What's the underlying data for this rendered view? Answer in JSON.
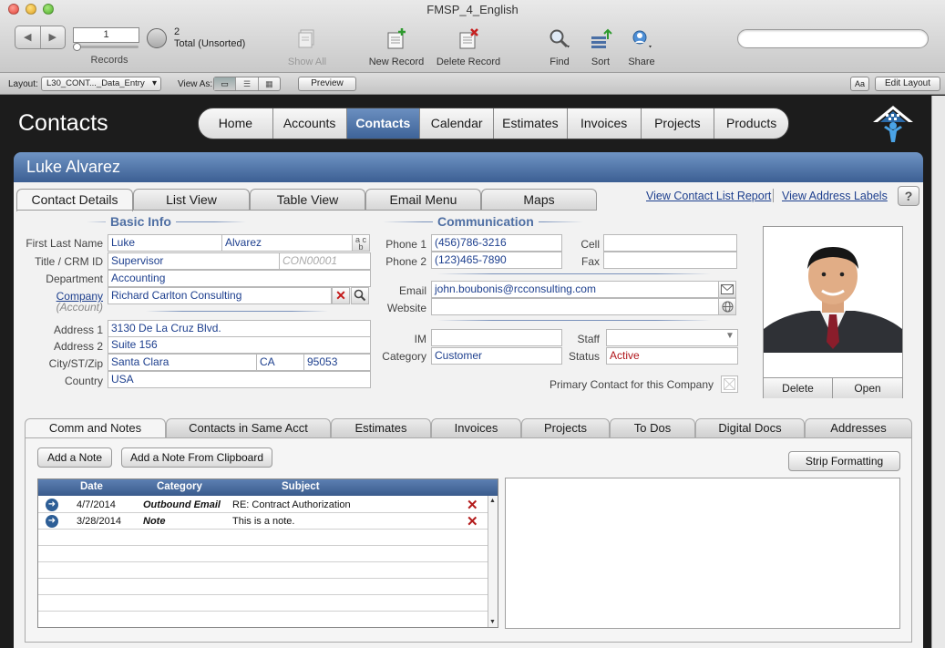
{
  "window": {
    "title": "FMSP_4_English"
  },
  "toolbar": {
    "record_number": "1",
    "records_label": "Records",
    "found_count": "2",
    "found_total": "Total (Unsorted)",
    "show_all": "Show All",
    "new_record": "New Record",
    "delete_record": "Delete Record",
    "find": "Find",
    "sort": "Sort",
    "share": "Share",
    "search_placeholder": ""
  },
  "layoutbar": {
    "layout_label": "Layout:",
    "layout_value": "L30_CONT..._Data_Entry",
    "view_as_label": "View As:",
    "preview": "Preview",
    "font_btn": "Aa",
    "edit_layout": "Edit Layout"
  },
  "header": {
    "title": "Contacts",
    "nav": [
      "Home",
      "Accounts",
      "Contacts",
      "Calendar",
      "Estimates",
      "Invoices",
      "Projects",
      "Products"
    ],
    "active_nav": "Contacts"
  },
  "record": {
    "name": "Luke Alvarez"
  },
  "tabs": [
    "Contact Details",
    "List View",
    "Table View",
    "Email Menu",
    "Maps"
  ],
  "links": {
    "list_report": "View Contact List Report",
    "address_labels": "View Address Labels",
    "help": "?"
  },
  "basic_info": {
    "title": "Basic Info",
    "labels": {
      "name": "First Last Name",
      "title": "Title / CRM ID",
      "department": "Department",
      "company": "Company",
      "account": "(Account)",
      "address1": "Address 1",
      "address2": "Address 2",
      "city": "City/ST/Zip",
      "country": "Country"
    },
    "first_name": "Luke",
    "last_name": "Alvarez",
    "job_title": "Supervisor",
    "crm_id": "CON00001",
    "department": "Accounting",
    "company": "Richard Carlton Consulting",
    "address1": "3130 De La Cruz Blvd.",
    "address2": "Suite 156",
    "city": "Santa Clara",
    "state": "CA",
    "zip": "95053",
    "country": "USA"
  },
  "communication": {
    "title": "Communication",
    "labels": {
      "phone1": "Phone 1",
      "phone2": "Phone 2",
      "cell": "Cell",
      "fax": "Fax",
      "email": "Email",
      "website": "Website",
      "im": "IM",
      "staff": "Staff",
      "category": "Category",
      "status": "Status",
      "primary": "Primary Contact for this Company"
    },
    "phone1": "(456)786-3216",
    "phone2": "(123)465-7890",
    "cell": "",
    "fax": "",
    "email": "john.boubonis@rcconsulting.com",
    "website": "",
    "im": "",
    "staff": "",
    "category": "Customer",
    "status": "Active"
  },
  "photo": {
    "delete": "Delete",
    "open": "Open"
  },
  "lower_tabs": [
    "Comm and Notes",
    "Contacts in Same Acct",
    "Estimates",
    "Invoices",
    "Projects",
    "To Dos",
    "Digital Docs",
    "Addresses"
  ],
  "notes": {
    "add_note": "Add a Note",
    "add_from_clipboard": "Add a Note From Clipboard",
    "strip_formatting": "Strip Formatting",
    "columns": [
      "Date",
      "Category",
      "Subject"
    ],
    "rows": [
      {
        "date": "4/7/2014",
        "category": "Outbound Email",
        "subject": "RE: Contract Authorization"
      },
      {
        "date": "3/28/2014",
        "category": "Note",
        "subject": "This is a note."
      }
    ]
  },
  "colors": {
    "accent": "#3e6398",
    "link": "#1d3f8e",
    "status_red": "#b0151a"
  }
}
